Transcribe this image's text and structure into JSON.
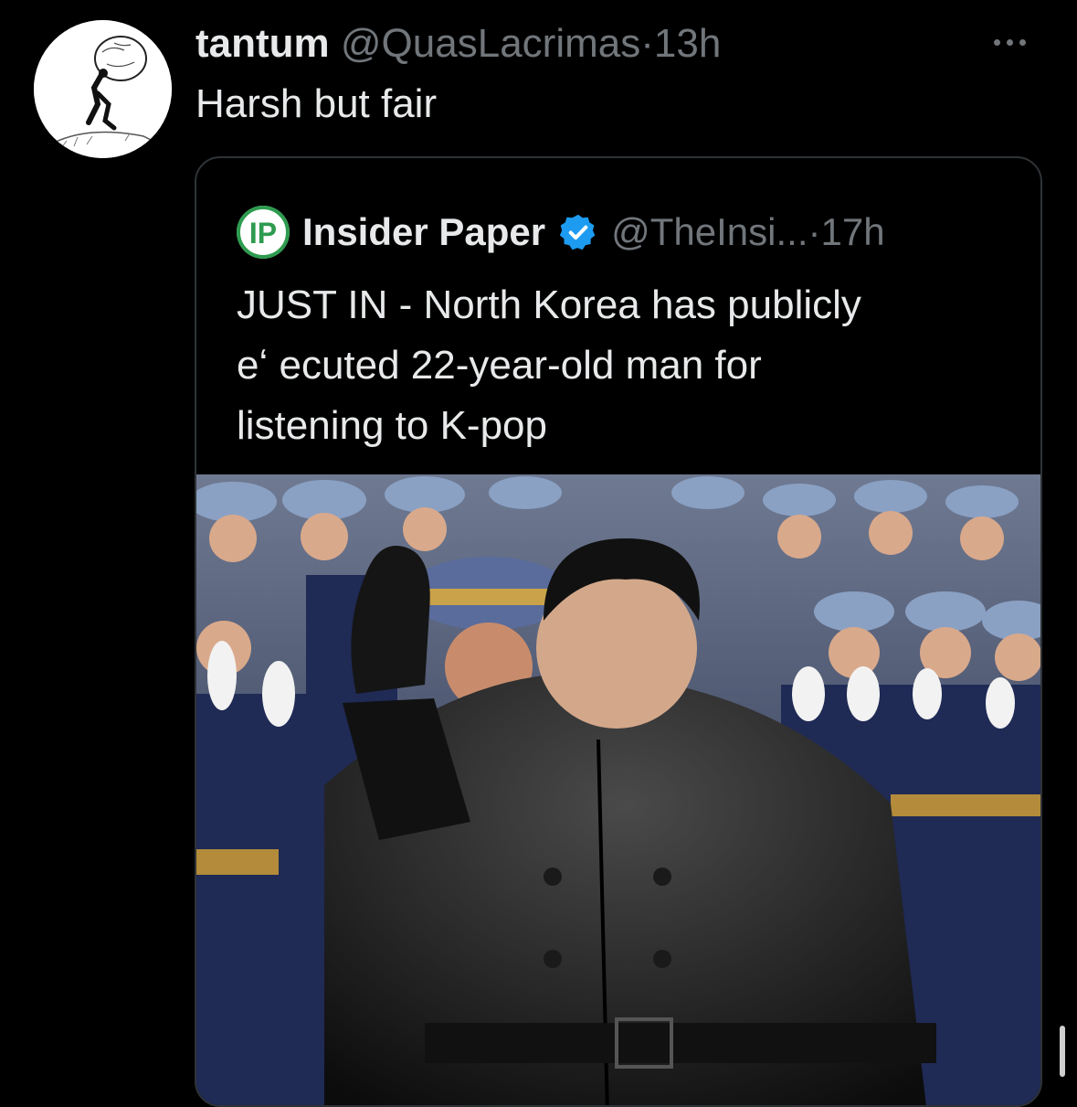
{
  "tweet": {
    "display_name": "tantum",
    "handle": "@QuasLacrimas",
    "separator": "·",
    "time": "13h",
    "text": "Harsh but fair",
    "avatar_icon": "sisyphus-boulder-drawing"
  },
  "quote": {
    "logo_text": "IP",
    "display_name": "Insider Paper",
    "verified": true,
    "handle": "@TheInsi...",
    "separator": "·",
    "time": "17h",
    "text_line_1": "JUST IN - North Korea has publicly",
    "text_line_2": "eʻ ecuted 22-year-old man for",
    "text_line_3": "listening to K-pop",
    "image_icon": "news-photo-leader-waving-with-officers"
  },
  "colors": {
    "background": "#000000",
    "text_primary": "#e7e9ea",
    "text_secondary": "#71767b",
    "border": "#2f3336",
    "verified_blue": "#1d9bf0",
    "logo_green": "#2e9b4f"
  }
}
